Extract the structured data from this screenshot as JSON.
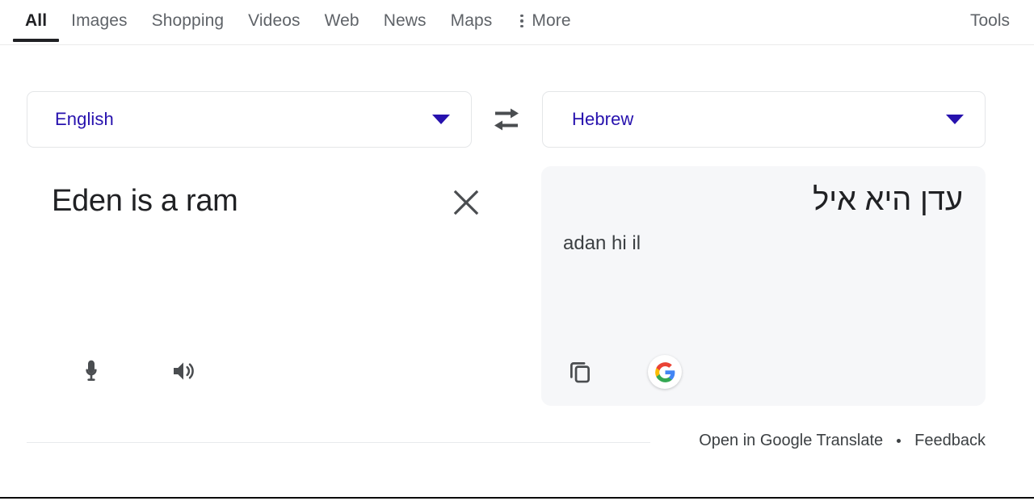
{
  "nav": {
    "tabs": [
      {
        "label": "All",
        "active": true
      },
      {
        "label": "Images",
        "active": false
      },
      {
        "label": "Shopping",
        "active": false
      },
      {
        "label": "Videos",
        "active": false
      },
      {
        "label": "Web",
        "active": false
      },
      {
        "label": "News",
        "active": false
      },
      {
        "label": "Maps",
        "active": false
      },
      {
        "label": "More",
        "active": false,
        "icon": "more-vert-icon"
      }
    ],
    "tools_label": "Tools"
  },
  "translate": {
    "source_language": "English",
    "target_language": "Hebrew",
    "swap_icon": "swap-horizontal-icon",
    "source_text": "Eden is a ram",
    "clear_icon": "close-icon",
    "mic_icon": "microphone-icon",
    "listen_icon": "volume-up-icon",
    "translated_text": "עדן היא איל",
    "transliteration": "adan hi il",
    "copy_icon": "copy-icon",
    "google_icon": "google-logo-icon"
  },
  "footer": {
    "open_link": "Open in Google Translate",
    "separator": "•",
    "feedback_link": "Feedback"
  },
  "colors": {
    "link_blue": "#2712ae",
    "text_primary": "#202124",
    "text_secondary": "#5f6368",
    "panel_bg": "#f6f7f9",
    "active_underline": "#202124"
  }
}
